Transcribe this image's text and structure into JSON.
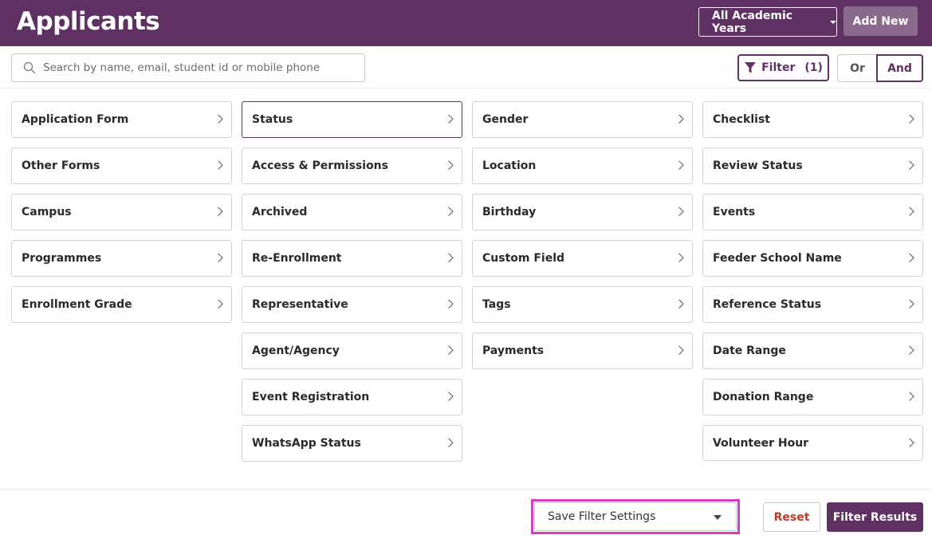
{
  "header": {
    "title": "Applicants",
    "year_select_label": "All Academic Years",
    "add_new_label": "Add New"
  },
  "search": {
    "placeholder": "Search by name, email, student id or mobile phone",
    "value": ""
  },
  "filter": {
    "label": "Filter",
    "count": "(1)",
    "or_label": "Or",
    "and_label": "And",
    "selected_logic": "And"
  },
  "columns": [
    {
      "items": [
        {
          "label": "Application Form"
        },
        {
          "label": "Other Forms"
        },
        {
          "label": "Campus"
        },
        {
          "label": "Programmes"
        },
        {
          "label": "Enrollment Grade"
        }
      ]
    },
    {
      "items": [
        {
          "label": "Status",
          "active": true
        },
        {
          "label": "Access & Permissions"
        },
        {
          "label": "Archived"
        },
        {
          "label": "Re-Enrollment"
        },
        {
          "label": "Representative"
        },
        {
          "label": "Agent/Agency"
        },
        {
          "label": "Event Registration"
        },
        {
          "label": "WhatsApp Status"
        }
      ]
    },
    {
      "items": [
        {
          "label": "Gender"
        },
        {
          "label": "Location"
        },
        {
          "label": "Birthday"
        },
        {
          "label": "Custom Field"
        },
        {
          "label": "Tags"
        },
        {
          "label": "Payments"
        }
      ]
    },
    {
      "items": [
        {
          "label": "Checklist"
        },
        {
          "label": "Review Status"
        },
        {
          "label": "Events"
        },
        {
          "label": "Feeder School Name"
        },
        {
          "label": "Reference Status"
        },
        {
          "label": "Date Range"
        },
        {
          "label": "Donation Range"
        },
        {
          "label": "Volunteer Hour"
        }
      ]
    }
  ],
  "footer": {
    "save_settings_label": "Save Filter Settings",
    "reset_label": "Reset",
    "filter_results_label": "Filter Results"
  },
  "colors": {
    "brand": "#5f3162",
    "add_new_bg": "#8a6a8c",
    "highlight": "#d23ec6",
    "reset_text": "#c0392b"
  },
  "icons": {
    "search": "search-icon",
    "filter": "funnel-icon",
    "item_arrow": "chevron-right-icon",
    "select": "caret-down-icon"
  }
}
